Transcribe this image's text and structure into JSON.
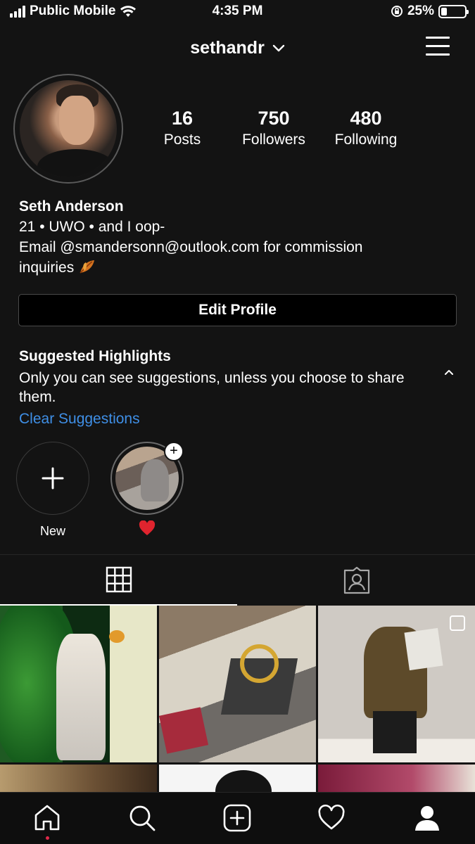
{
  "status_bar": {
    "carrier": "Public Mobile",
    "time": "4:35 PM",
    "battery_percent": "25%",
    "battery_level": 0.25
  },
  "header": {
    "username": "sethandr"
  },
  "profile": {
    "stats": [
      {
        "value": "16",
        "label": "Posts"
      },
      {
        "value": "750",
        "label": "Followers"
      },
      {
        "value": "480",
        "label": "Following"
      }
    ],
    "name": "Seth Anderson",
    "bio_line1": "21 • UWO • and I oop-",
    "bio_line2": "Email @smandersonn@outlook.com for commission",
    "bio_line3": "inquiries",
    "edit_button": "Edit Profile"
  },
  "suggested_highlights": {
    "title": "Suggested Highlights",
    "description": "Only you can see suggestions, unless you choose to share them.",
    "clear_link": "Clear Suggestions",
    "items": [
      {
        "label": "New"
      },
      {
        "label": "❤️"
      }
    ]
  },
  "icons": {
    "status": [
      "signal-icon",
      "wifi-icon",
      "orientation-lock-icon",
      "battery-icon"
    ],
    "header": [
      "chevron-down-icon",
      "hamburger-menu-icon"
    ],
    "tabs": [
      "grid-icon",
      "tagged-icon"
    ],
    "nav": [
      "home-icon",
      "search-icon",
      "add-post-icon",
      "heart-icon",
      "profile-icon"
    ]
  },
  "colors": {
    "background": "#131313",
    "link": "#3f8fe6",
    "notification_dot": "#e0294a"
  }
}
